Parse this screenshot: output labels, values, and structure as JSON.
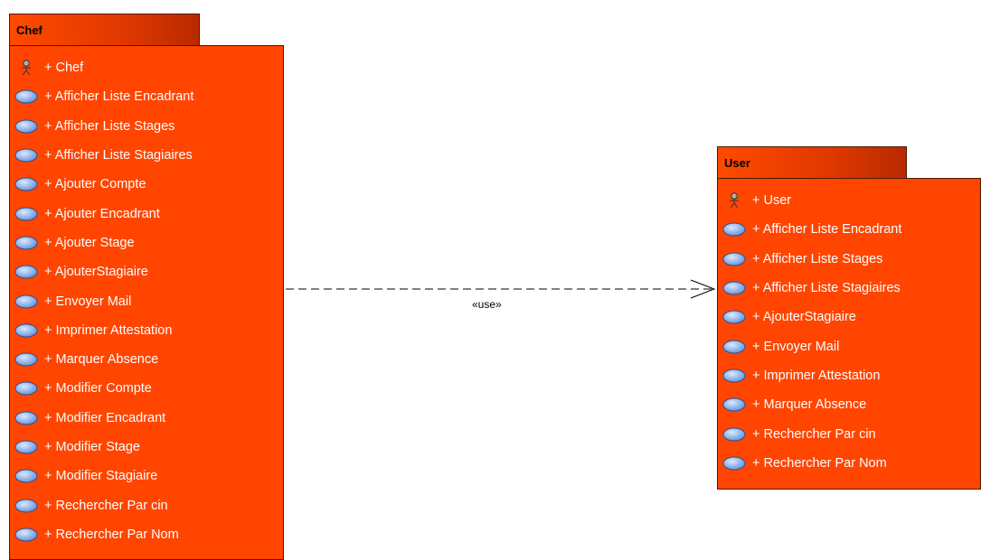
{
  "chef": {
    "title": "Chef",
    "items": [
      {
        "kind": "actor",
        "label": "+ Chef"
      },
      {
        "kind": "usecase",
        "label": "+ Afficher Liste Encadrant"
      },
      {
        "kind": "usecase",
        "label": "+ Afficher Liste Stages"
      },
      {
        "kind": "usecase",
        "label": "+ Afficher Liste Stagiaires"
      },
      {
        "kind": "usecase",
        "label": "+ Ajouter Compte"
      },
      {
        "kind": "usecase",
        "label": "+ Ajouter Encadrant"
      },
      {
        "kind": "usecase",
        "label": "+ Ajouter Stage"
      },
      {
        "kind": "usecase",
        "label": "+ AjouterStagiaire"
      },
      {
        "kind": "usecase",
        "label": "+ Envoyer Mail"
      },
      {
        "kind": "usecase",
        "label": "+ Imprimer Attestation"
      },
      {
        "kind": "usecase",
        "label": "+ Marquer Absence"
      },
      {
        "kind": "usecase",
        "label": "+ Modifier Compte"
      },
      {
        "kind": "usecase",
        "label": "+ Modifier Encadrant"
      },
      {
        "kind": "usecase",
        "label": "+ Modifier Stage"
      },
      {
        "kind": "usecase",
        "label": "+ Modifier Stagiaire"
      },
      {
        "kind": "usecase",
        "label": "+ Rechercher Par cin"
      },
      {
        "kind": "usecase",
        "label": "+ Rechercher Par Nom"
      }
    ]
  },
  "user": {
    "title": "User",
    "items": [
      {
        "kind": "actor",
        "label": "+ User"
      },
      {
        "kind": "usecase",
        "label": "+ Afficher Liste Encadrant"
      },
      {
        "kind": "usecase",
        "label": "+ Afficher Liste Stages"
      },
      {
        "kind": "usecase",
        "label": "+ Afficher Liste Stagiaires"
      },
      {
        "kind": "usecase",
        "label": "+ AjouterStagiaire"
      },
      {
        "kind": "usecase",
        "label": "+ Envoyer Mail"
      },
      {
        "kind": "usecase",
        "label": "+ Imprimer Attestation"
      },
      {
        "kind": "usecase",
        "label": "+ Marquer Absence"
      },
      {
        "kind": "usecase",
        "label": "+ Rechercher Par cin"
      },
      {
        "kind": "usecase",
        "label": "+ Rechercher Par Nom"
      }
    ]
  },
  "dependency": {
    "stereotype": "«use»",
    "from": "Chef",
    "to": "User"
  },
  "colors": {
    "package_fill": "#ff4500",
    "package_border": "#4a1a00",
    "usecase_icon": "#6fa0e8",
    "item_text": "#ffffff"
  }
}
